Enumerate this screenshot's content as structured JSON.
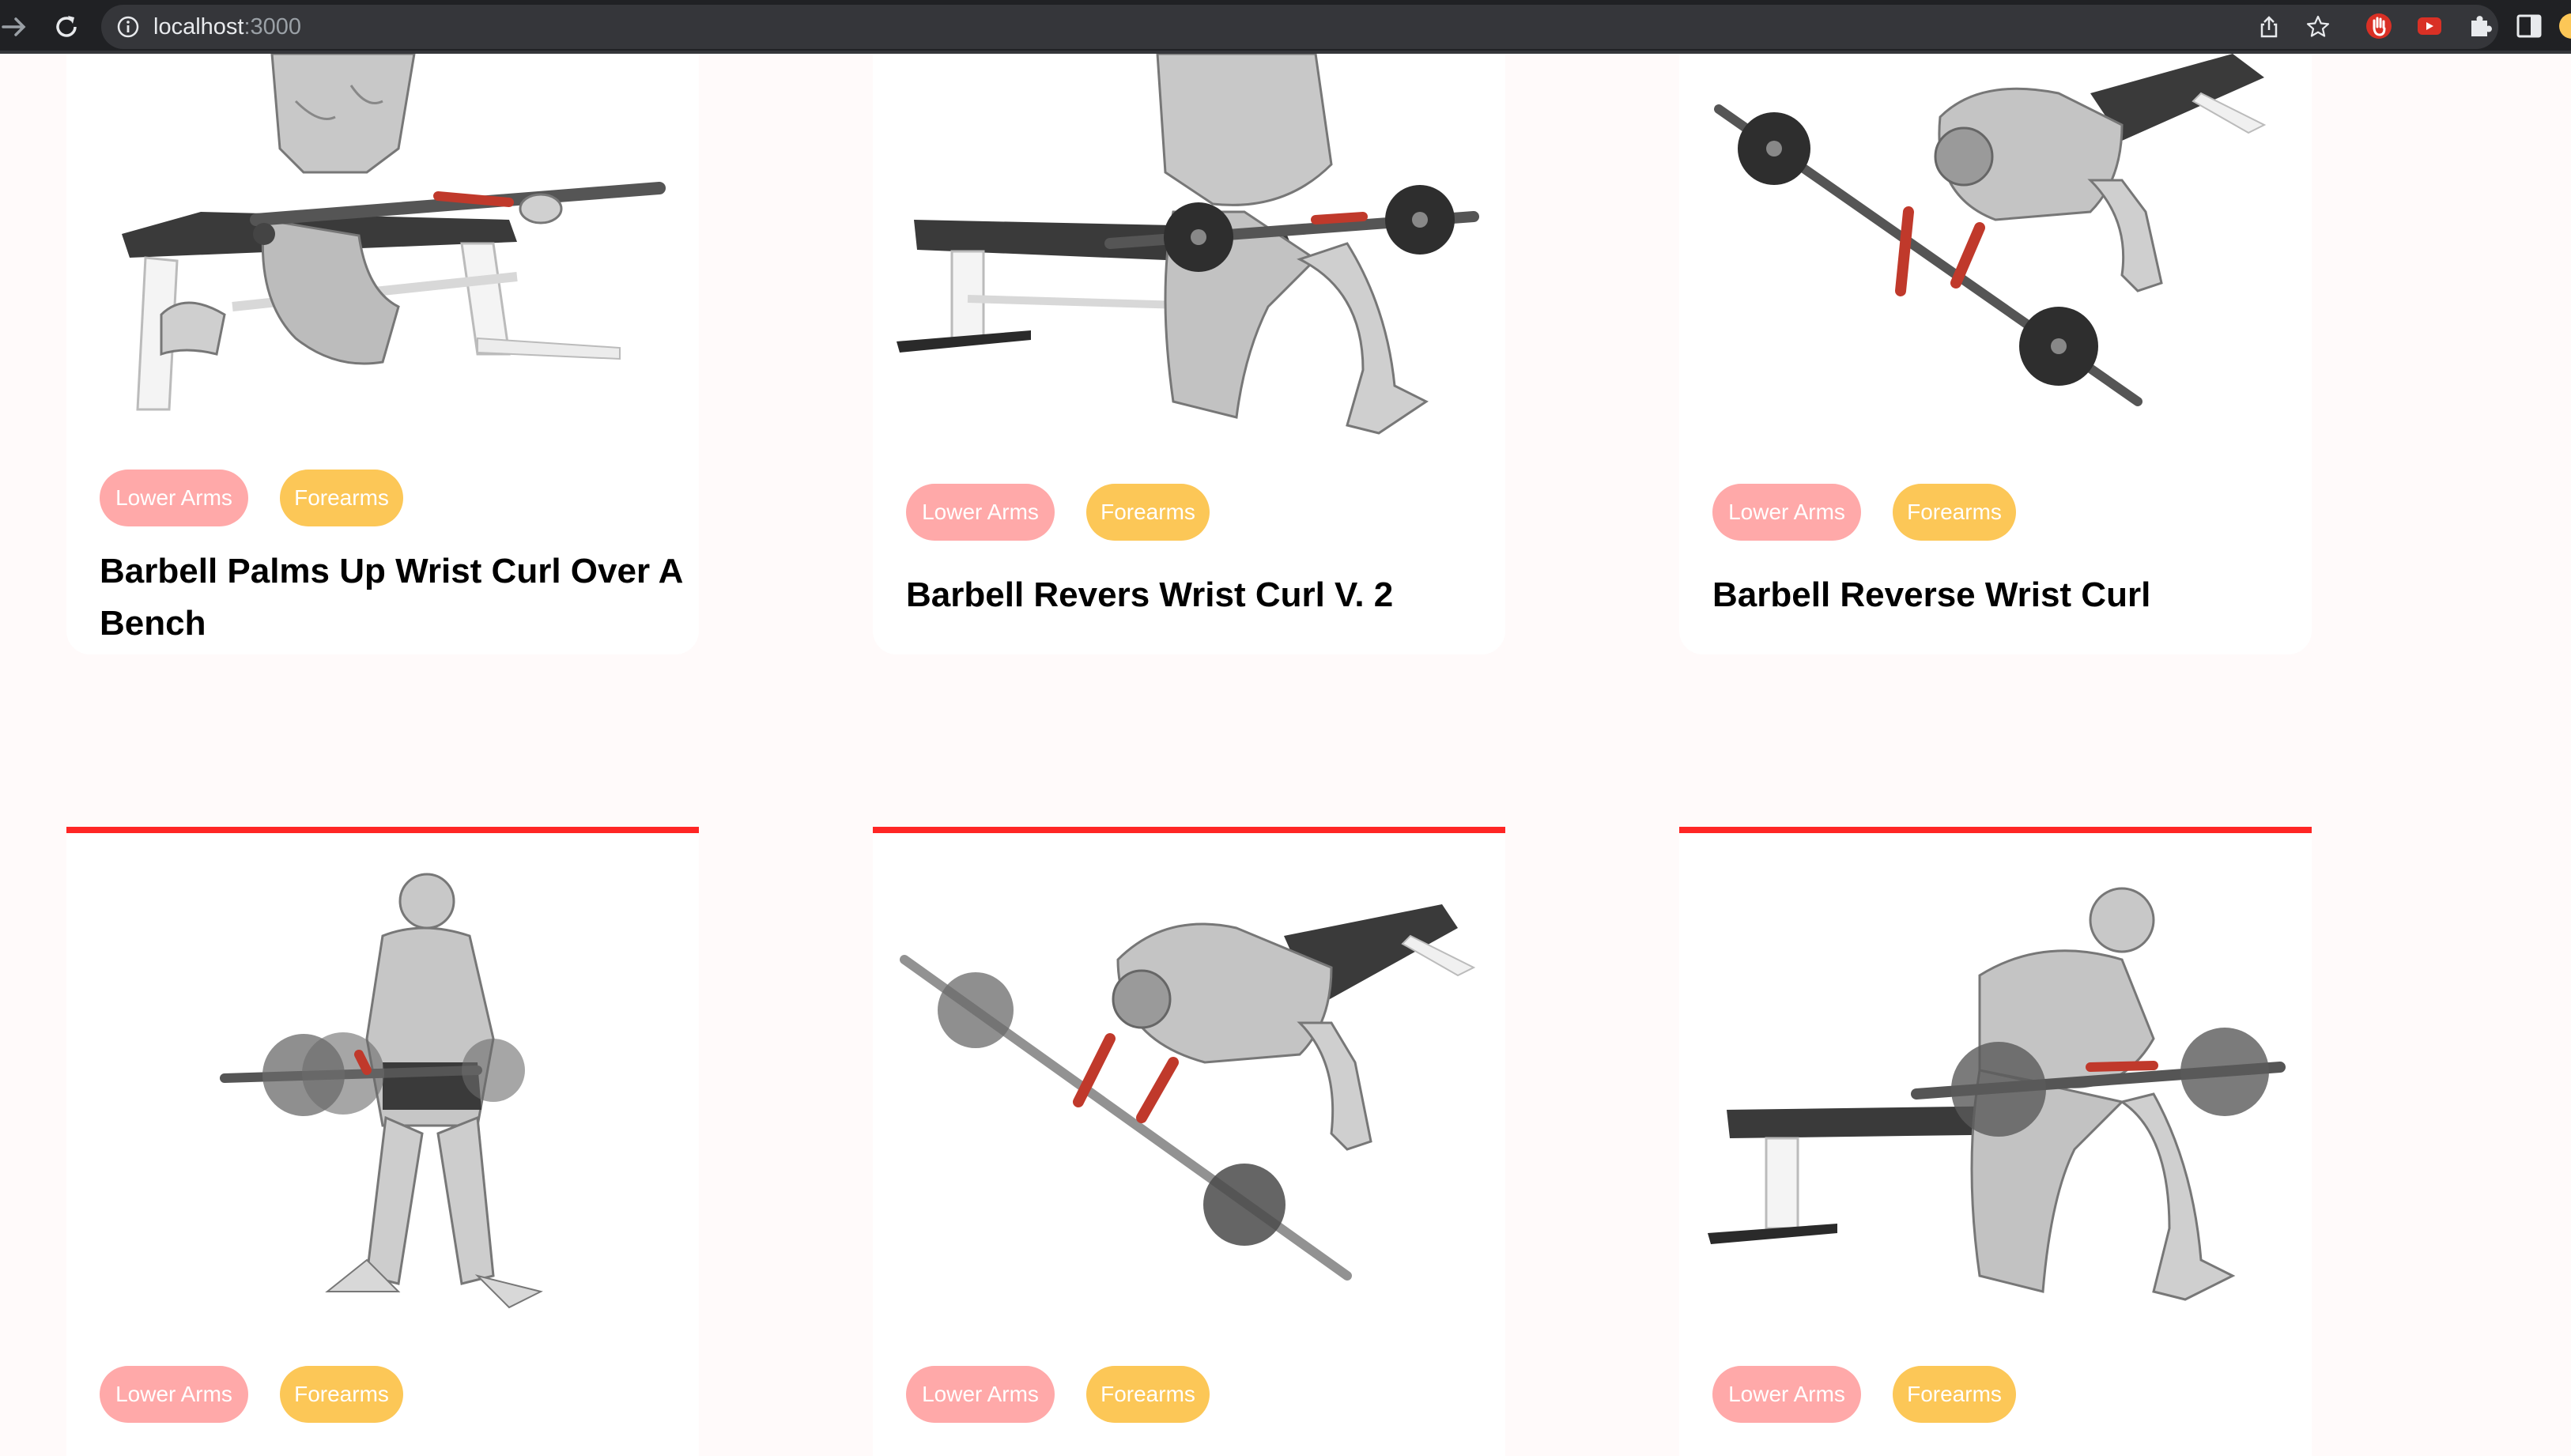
{
  "browser": {
    "url_host": "localhost",
    "url_port": ":3000"
  },
  "exercises": [
    {
      "name": "Barbell Palms Up Wrist Curl Over A Bench",
      "body_part": "Lower Arms",
      "target": "Forearms"
    },
    {
      "name": "Barbell Revers Wrist Curl V. 2",
      "body_part": "Lower Arms",
      "target": "Forearms"
    },
    {
      "name": "Barbell Reverse Wrist Curl",
      "body_part": "Lower Arms",
      "target": "Forearms"
    },
    {
      "body_part": "Lower Arms",
      "target": "Forearms"
    },
    {
      "body_part": "Lower Arms",
      "target": "Forearms"
    },
    {
      "body_part": "Lower Arms",
      "target": "Forearms"
    }
  ],
  "colors": {
    "page_bg": "#fffafa",
    "card_accent": "#ff2625",
    "body_part_pill": "#ffa9a9",
    "target_pill": "#fcc757"
  }
}
